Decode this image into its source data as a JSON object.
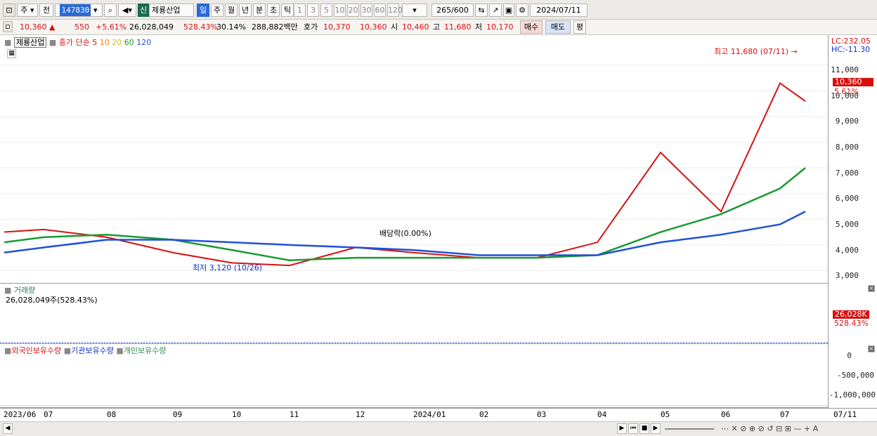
{
  "toolbar": {
    "type_label": "주",
    "all_label": "전",
    "code": "147830",
    "shin_badge": "신",
    "stock_name": "제룡산업",
    "periods": [
      "일",
      "주",
      "월",
      "년",
      "분",
      "초",
      "틱"
    ],
    "selected_period": "일",
    "minutes": [
      "1",
      "3",
      "5",
      "10",
      "20",
      "30",
      "60",
      "120"
    ],
    "count_value": "265",
    "count_total": "/600",
    "date_value": "2024/07/11"
  },
  "quote": {
    "price": "10,360 ▲",
    "change": "550",
    "change_pct": "+5.61%",
    "volume": "26,028,049",
    "volume_ratio": "528.43%",
    "turnover": "30.14%",
    "amount": "288,882백만",
    "hoga_label": "호가",
    "ask": "10,370",
    "bid": "10,360",
    "open_label": "시",
    "open": "10,460",
    "high_label": "고",
    "high": "11,680",
    "low_label": "저",
    "low": "10,170",
    "buy_btn": "매수",
    "sell_btn": "매도",
    "eval_btn": "평"
  },
  "price_pane": {
    "stock_tag": "제룡산업",
    "ma_label": "종가 단순",
    "ma_periods": [
      "5",
      "10",
      "20",
      "60",
      "120"
    ],
    "ma_colors": [
      "#d81010",
      "#f08010",
      "#f0e040",
      "#1a9a30",
      "#2050d8"
    ],
    "lc": "LC:232.05",
    "hc": "HC:-11.30",
    "current_price_badge": "10,360",
    "current_pct_badge": "5.61%",
    "max_note": "최고 11,680 (07/11)",
    "min_note": "최저 3,120 (10/26)",
    "dividend_note": "배당락(0.00%)",
    "y_ticks": [
      "11,000",
      "10,000",
      "9,000",
      "8,000",
      "7,000",
      "6,000",
      "5,000",
      "4,000",
      "3,000"
    ]
  },
  "volume_pane": {
    "title": "거래량",
    "value": "26,028,049주(528.43%)",
    "badge_value": "26,028K",
    "badge_pct": "528.43%"
  },
  "holdings_pane": {
    "legend": [
      "외국인보유수량",
      "기관보유수량",
      "개인보유수량"
    ],
    "colors": [
      "#d81010",
      "#2050d8",
      "#2a8a50"
    ],
    "y_ticks": [
      "0",
      "-500,000",
      "-1,000,000"
    ]
  },
  "x_axis": [
    "2023/06",
    "07",
    "08",
    "09",
    "10",
    "11",
    "12",
    "2024/01",
    "02",
    "03",
    "04",
    "05",
    "06",
    "07",
    "07/11"
  ],
  "chart_data": {
    "type": "line",
    "series": [
      {
        "name": "종가 단순 5",
        "x": [
          "2023/06",
          "07",
          "08",
          "09",
          "10",
          "11",
          "12",
          "2024/01",
          "02",
          "03",
          "04",
          "05",
          "06",
          "07",
          "07/11"
        ],
        "values": [
          4500,
          4600,
          4300,
          3700,
          3300,
          3200,
          3900,
          3700,
          3500,
          3500,
          4100,
          7600,
          5300,
          10300,
          9600
        ]
      },
      {
        "name": "종가 단순 60",
        "x": [
          "2023/06",
          "07",
          "08",
          "09",
          "10",
          "11",
          "12",
          "2024/01",
          "02",
          "03",
          "04",
          "05",
          "06",
          "07",
          "07/11"
        ],
        "values": [
          4100,
          4300,
          4400,
          4200,
          3800,
          3400,
          3500,
          3500,
          3500,
          3500,
          3600,
          4500,
          5200,
          6200,
          7000
        ]
      },
      {
        "name": "종가 단순 120",
        "x": [
          "2023/06",
          "07",
          "08",
          "09",
          "10",
          "11",
          "12",
          "2024/01",
          "02",
          "03",
          "04",
          "05",
          "06",
          "07",
          "07/11"
        ],
        "values": [
          3700,
          3900,
          4200,
          4200,
          4100,
          4000,
          3900,
          3800,
          3600,
          3600,
          3600,
          4100,
          4400,
          4800,
          5300
        ]
      }
    ],
    "ylim": [
      2600,
      11900
    ]
  }
}
